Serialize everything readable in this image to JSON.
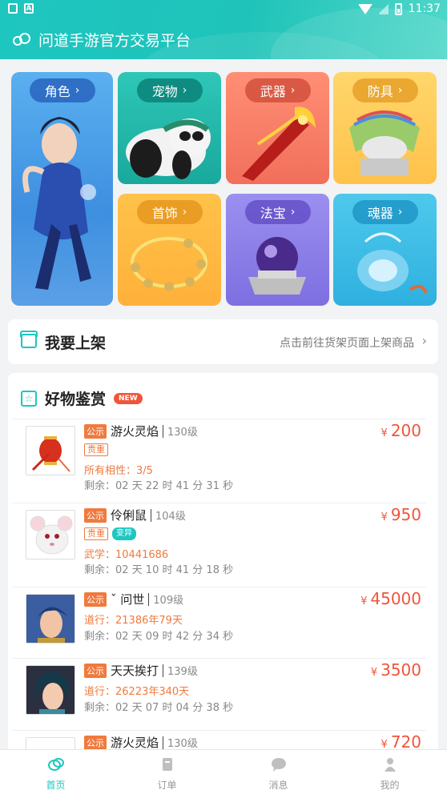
{
  "status_bar": {
    "time": "11:37",
    "left_icons": [
      "lock-icon",
      "a-icon"
    ],
    "right_icons": [
      "wifi-icon",
      "signal-icon",
      "battery-icon"
    ]
  },
  "header": {
    "title": "问道手游官方交易平台",
    "accent_color": "#1ec6c0"
  },
  "categories": [
    {
      "label": "角色",
      "chevron": "›"
    },
    {
      "label": "宠物",
      "chevron": "›"
    },
    {
      "label": "武器",
      "chevron": "›"
    },
    {
      "label": "防具",
      "chevron": "›"
    },
    {
      "label": "首饰",
      "chevron": "›"
    },
    {
      "label": "法宝",
      "chevron": "›"
    },
    {
      "label": "魂器",
      "chevron": "›"
    }
  ],
  "shelf": {
    "title": "我要上架",
    "hint": "点击前往货架页面上架商品",
    "arrow": "›"
  },
  "goods": {
    "title": "好物鉴赏",
    "badge": "NEW",
    "items": [
      {
        "tag": "公示",
        "name": "游火灵焰",
        "level": "130级",
        "tags": [
          "贵重"
        ],
        "attr": "所有相性：3/5",
        "remain": "剩余：02 天 22 时 41 分 31 秒",
        "currency": "¥",
        "price": "200"
      },
      {
        "tag": "公示",
        "name": "伶俐鼠",
        "level": "104级",
        "tags": [
          "贵重",
          "变异"
        ],
        "attr": "武学：10441686",
        "remain": "剩余：02 天 10 时 41 分 18 秒",
        "currency": "¥",
        "price": "950"
      },
      {
        "tag": "公示",
        "name": "ˇ  问世",
        "level": "109级",
        "tags": [],
        "attr": "道行：21386年79天",
        "remain": "剩余：02 天 09 时 42 分 34 秒",
        "currency": "¥",
        "price": "45000"
      },
      {
        "tag": "公示",
        "name": "天天挨打",
        "level": "139级",
        "tags": [],
        "attr": "道行：26223年340天",
        "remain": "剩余：02 天 07 时 04 分 38 秒",
        "currency": "¥",
        "price": "3500"
      },
      {
        "tag": "公示",
        "name": "游火灵焰",
        "level": "130级",
        "tags": [],
        "attr": "",
        "remain": "",
        "currency": "¥",
        "price": "720"
      }
    ]
  },
  "tabbar": [
    {
      "label": "首页",
      "icon": "home-icon",
      "active": true
    },
    {
      "label": "订单",
      "icon": "order-icon",
      "active": false
    },
    {
      "label": "消息",
      "icon": "message-icon",
      "active": false
    },
    {
      "label": "我的",
      "icon": "profile-icon",
      "active": false
    }
  ]
}
